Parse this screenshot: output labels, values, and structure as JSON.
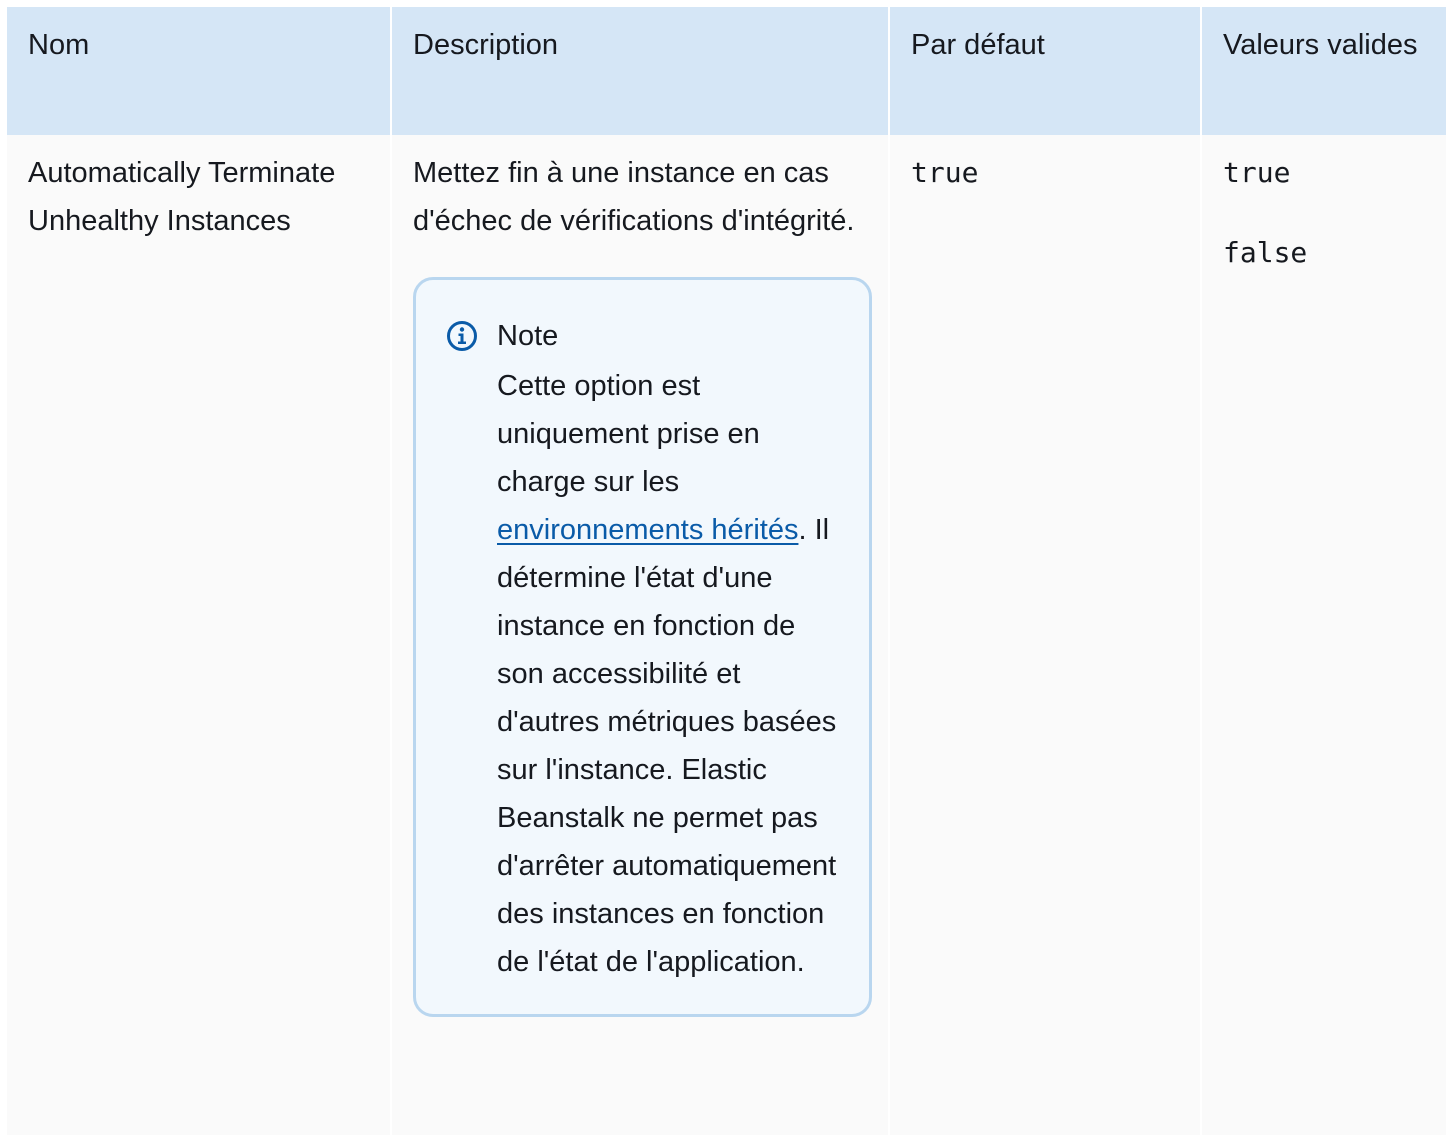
{
  "table": {
    "headers": {
      "name": "Nom",
      "description": "Description",
      "default": "Par défaut",
      "valid_values": "Valeurs valides"
    },
    "rows": [
      {
        "name": "Automatically Terminate Unhealthy Instances",
        "description": "Mettez fin à une instance en cas d'échec de vérifications d'intégrité.",
        "note": {
          "title": "Note",
          "body_before_link": "Cette option est uniquement prise en charge sur les",
          "link_text": "environnements hérités",
          "body_after_link": ". Il détermine l'état d'une instance en fonction de son accessibilité et d'autres métriques basées sur l'instance. Elastic Beanstalk ne permet pas d'arrêter automatiquement des instances en fonction de l'état de l'application."
        },
        "default": "true",
        "valid_values": [
          "true",
          "false"
        ]
      }
    ]
  },
  "colors": {
    "header_bg": "#d5e6f6",
    "row_bg": "#fafafa",
    "note_border": "#b9d6ef",
    "note_bg": "#f2f8fd",
    "info_icon": "#0a5ba8",
    "link": "#0a5ba8"
  },
  "icons": {
    "note": "info-circle-icon"
  }
}
